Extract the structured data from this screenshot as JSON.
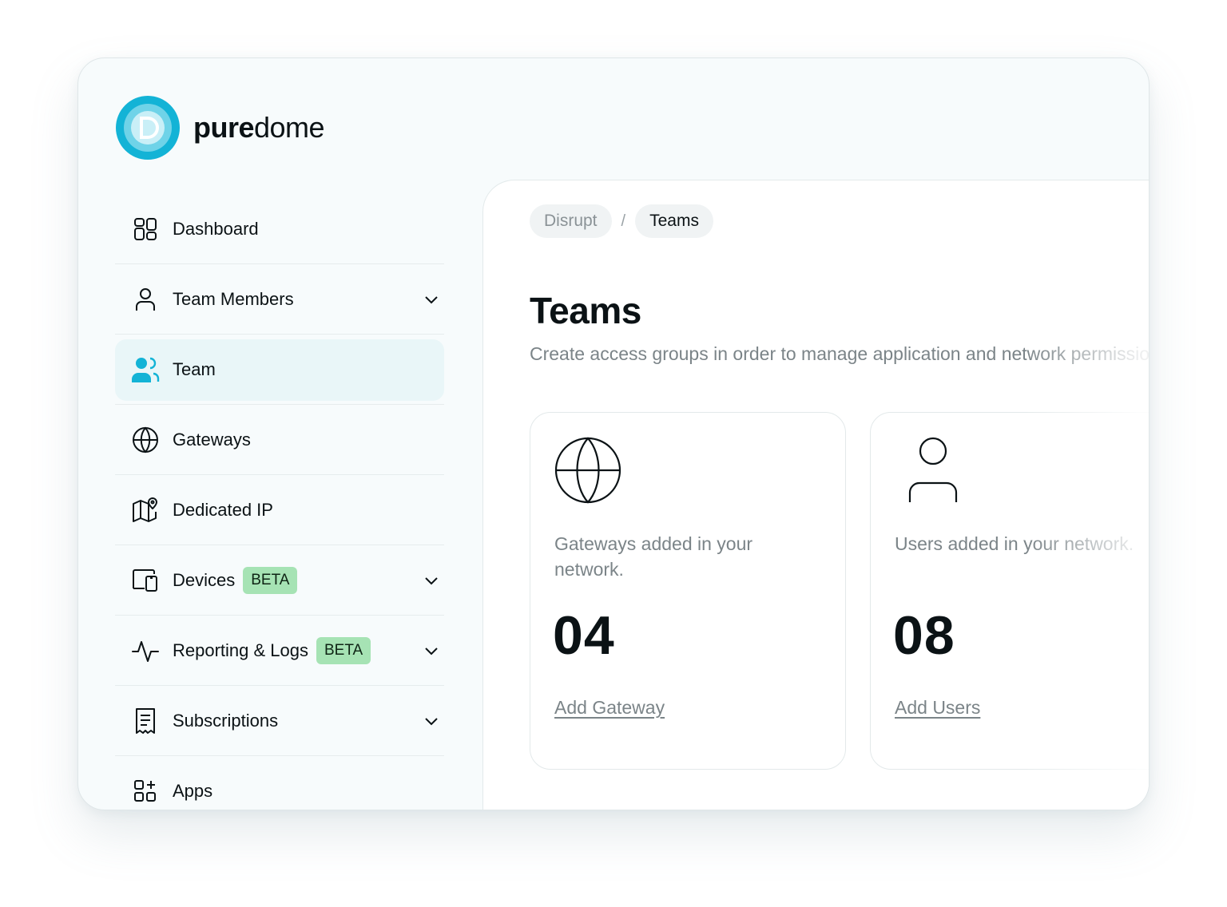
{
  "brand": {
    "name_bold": "pure",
    "name_light": "dome",
    "color": "#13b3d6"
  },
  "sidebar": {
    "items": [
      {
        "label": "Dashboard",
        "icon": "dashboard-icon"
      },
      {
        "label": "Team Members",
        "icon": "user-icon",
        "expandable": true
      },
      {
        "label": "Team",
        "icon": "users-icon",
        "active": true
      },
      {
        "label": "Gateways",
        "icon": "globe-icon"
      },
      {
        "label": "Dedicated IP",
        "icon": "map-pin-icon"
      },
      {
        "label": "Devices",
        "icon": "devices-icon",
        "badge": "BETA",
        "expandable": true
      },
      {
        "label": "Reporting & Logs",
        "icon": "activity-icon",
        "badge": "BETA",
        "expandable": true
      },
      {
        "label": "Subscriptions",
        "icon": "receipt-icon",
        "expandable": true
      },
      {
        "label": "Apps",
        "icon": "apps-icon"
      }
    ]
  },
  "breadcrumb": {
    "parent": "Disrupt",
    "separator": "/",
    "current": "Teams"
  },
  "main": {
    "title": "Teams",
    "subtitle": "Create access groups in order to manage application and network permissions"
  },
  "cards": [
    {
      "icon": "globe-icon",
      "description": "Gateways added in your network.",
      "count": "04",
      "link": "Add Gateway"
    },
    {
      "icon": "user-icon",
      "description": "Users added in your network.",
      "count": "08",
      "link": "Add Users"
    }
  ],
  "colors": {
    "accent": "#13b3d6",
    "active_bg": "#e9f6f8",
    "badge_bg": "#a6e3b4"
  }
}
